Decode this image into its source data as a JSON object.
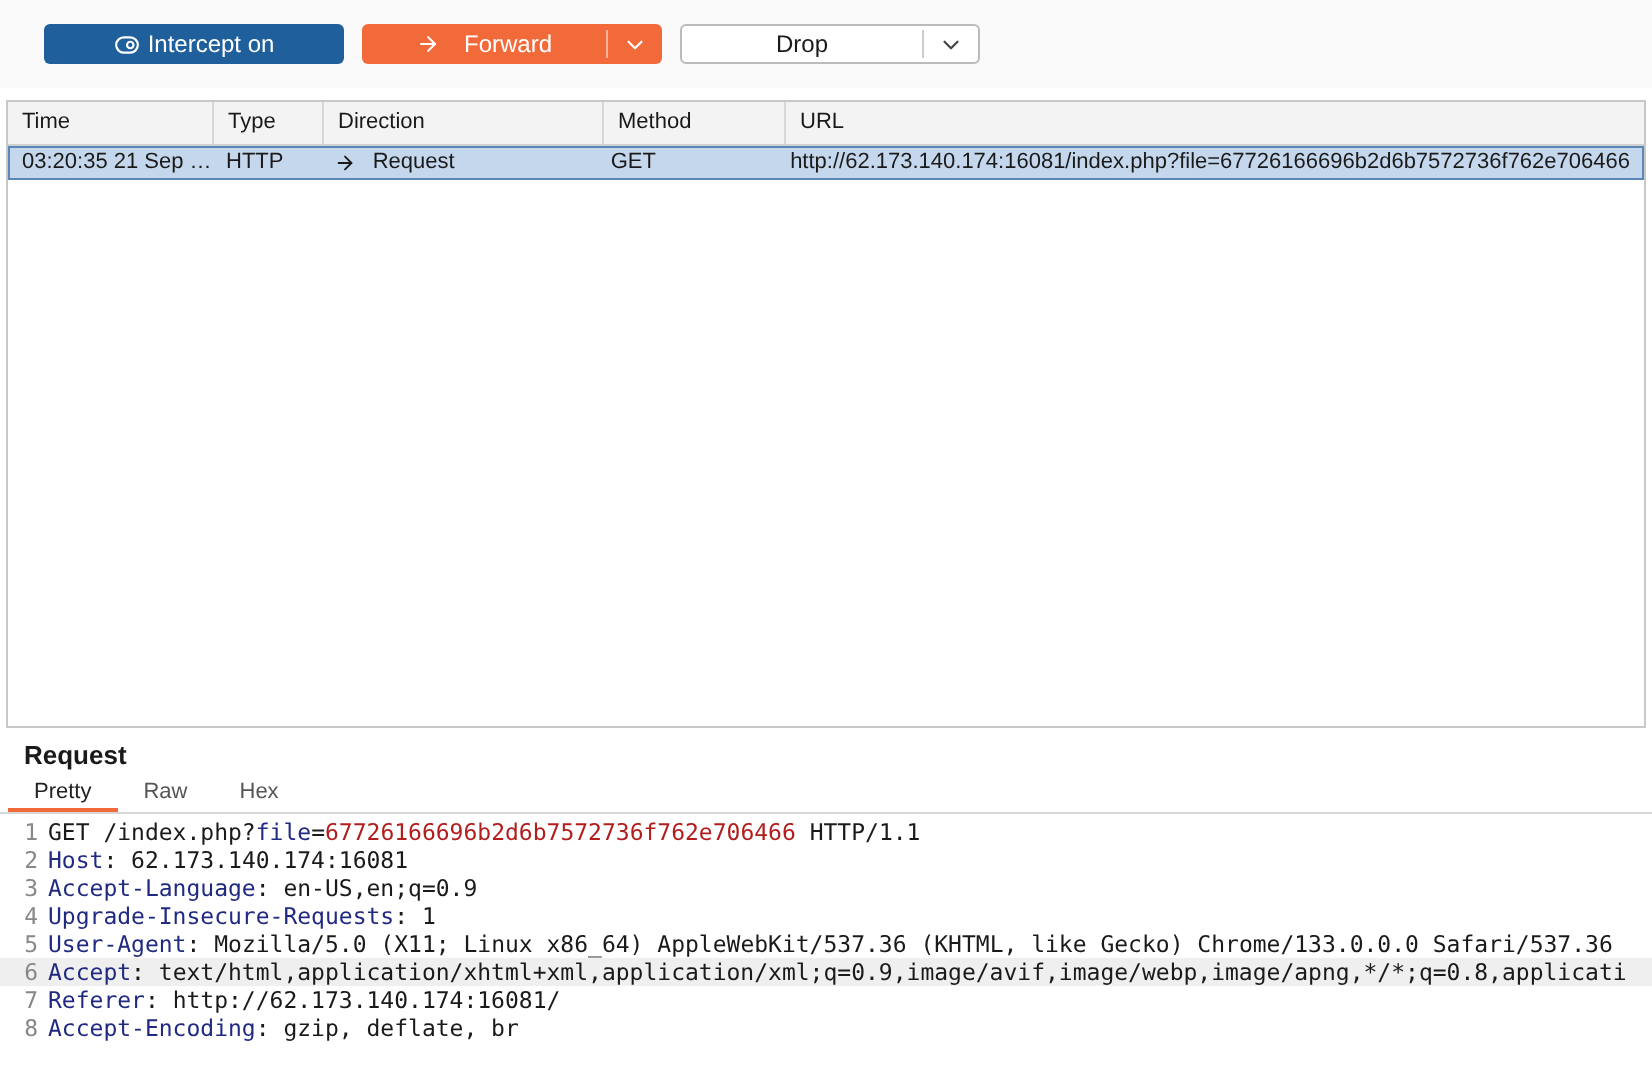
{
  "toolbar": {
    "intercept": {
      "label": "Intercept on",
      "on": true
    },
    "forward": {
      "label": "Forward"
    },
    "drop": {
      "label": "Drop"
    }
  },
  "table": {
    "columns": [
      "Time",
      "Type",
      "Direction",
      "Method",
      "URL"
    ],
    "rows": [
      {
        "selected": true,
        "cells": [
          "03:20:35 21 Sep …",
          "HTTP",
          "Request",
          "GET",
          "http://62.173.140.174:16081/index.php?file=67726166696b2d6b7572736f762e706466"
        ]
      }
    ]
  },
  "request": {
    "title": "Request",
    "tabs": [
      {
        "label": "Pretty",
        "selected": true
      },
      {
        "label": "Raw",
        "selected": false
      },
      {
        "label": "Hex",
        "selected": false
      }
    ],
    "lines": [
      {
        "number": "1",
        "current": false,
        "parts": [
          {
            "kind": "plain",
            "text": "GET /index.php?"
          },
          {
            "kind": "param_name",
            "text": "file"
          },
          {
            "kind": "plain",
            "text": "="
          },
          {
            "kind": "param_value",
            "text": "67726166696b2d6b7572736f762e706466"
          },
          {
            "kind": "plain",
            "text": " HTTP/1.1"
          }
        ]
      },
      {
        "number": "2",
        "current": false,
        "parts": [
          {
            "kind": "header_name",
            "text": "Host"
          },
          {
            "kind": "plain",
            "text": ": 62.173.140.174:16081"
          }
        ]
      },
      {
        "number": "3",
        "current": false,
        "parts": [
          {
            "kind": "header_name",
            "text": "Accept-Language"
          },
          {
            "kind": "plain",
            "text": ": en-US,en;q=0.9"
          }
        ]
      },
      {
        "number": "4",
        "current": false,
        "parts": [
          {
            "kind": "header_name",
            "text": "Upgrade-Insecure-Requests"
          },
          {
            "kind": "plain",
            "text": ": 1"
          }
        ]
      },
      {
        "number": "5",
        "current": false,
        "parts": [
          {
            "kind": "header_name",
            "text": "User-Agent"
          },
          {
            "kind": "plain",
            "text": ": Mozilla/5.0 (X11; Linux x86_64) AppleWebKit/537.36 (KHTML, like Gecko) Chrome/133.0.0.0 Safari/537.36"
          }
        ]
      },
      {
        "number": "6",
        "current": true,
        "parts": [
          {
            "kind": "header_name",
            "text": "Accept"
          },
          {
            "kind": "plain",
            "text": ": text/html,application/xhtml+xml,application/xml;q=0.9,image/avif,image/webp,image/apng,*/*;q=0.8,applicati"
          }
        ]
      },
      {
        "number": "7",
        "current": false,
        "parts": [
          {
            "kind": "header_name",
            "text": "Referer"
          },
          {
            "kind": "plain",
            "text": ": http://62.173.140.174:16081/"
          }
        ]
      },
      {
        "number": "8",
        "current": false,
        "parts": [
          {
            "kind": "header_name",
            "text": "Accept-Encoding"
          },
          {
            "kind": "plain",
            "text": ": gzip, deflate, br"
          }
        ]
      }
    ]
  }
}
